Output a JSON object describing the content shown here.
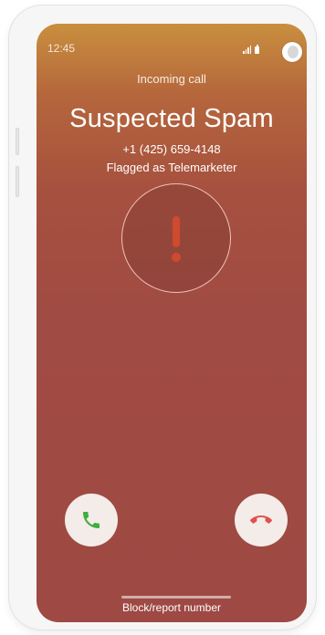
{
  "status_bar": {
    "time": "12:45",
    "signal_icon": "signal-icon",
    "battery_icon": "battery-icon"
  },
  "call": {
    "heading": "Incoming call",
    "caller_name": "Suspected Spam",
    "phone_number": "+1 (425) 659-4148",
    "flag_text": "Flagged as Telemarketer",
    "avatar_icon": "warning-icon"
  },
  "actions": {
    "accept_icon": "phone-answer-icon",
    "decline_icon": "phone-hangup-icon",
    "block_label": "Block/report number"
  },
  "colors": {
    "background_top": "#c98f3e",
    "background_bottom": "#9e4943",
    "accept": "#3fae3f",
    "decline": "#e0504f",
    "warning": "#d04a2e"
  }
}
